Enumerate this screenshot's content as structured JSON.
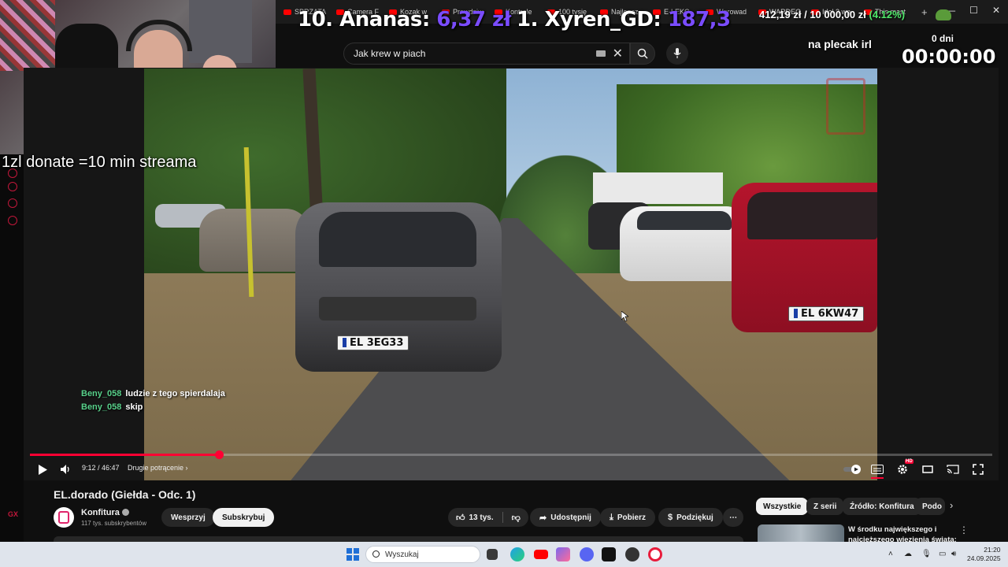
{
  "browser": {
    "tabs": [
      {
        "label": "SPRZATA",
        "icon": "youtube-icon"
      },
      {
        "label": "Camera F",
        "icon": "youtube-icon"
      },
      {
        "label": "Kozak w",
        "icon": "youtube-icon"
      },
      {
        "label": "Prawdziw",
        "icon": "youtube-icon"
      },
      {
        "label": "Kontrole",
        "icon": "youtube-icon"
      },
      {
        "label": "100 tysię",
        "icon": "youtube-icon"
      },
      {
        "label": "Najlepsz",
        "icon": "youtube-icon"
      },
      {
        "label": "E-LEKC",
        "icon": "youtube-icon"
      },
      {
        "label": "Wprowad",
        "icon": "youtube-icon"
      },
      {
        "label": "WARDEG",
        "icon": "youtube-icon"
      },
      {
        "label": "Idol 3 wp",
        "icon": "youtube-icon"
      },
      {
        "label": "This mast",
        "icon": "youtube-icon"
      }
    ],
    "new_tab": "+"
  },
  "overlay": {
    "rank10_label": "10. Ananas:",
    "rank10_amount": "6,37 zł",
    "rank1_label": "1. Xyren_GD:",
    "rank1_amount": "187,3",
    "goal_amount": "412,19 zł / 10 000,00 zł",
    "goal_pct": "(4.12%)",
    "backpack": "na plecak irl",
    "days": "0 dni",
    "timer": "00:00:00",
    "donate": "1zl donate =10 min streama"
  },
  "search": {
    "value": "Jak krew w piach"
  },
  "chat": [
    {
      "user": "Beny_058",
      "message": "ludzie z tego spierdalaja"
    },
    {
      "user": "Beny_058",
      "message": "skip"
    }
  ],
  "video": {
    "plate_vw": "EL 3EG33",
    "plate_red": "EL 6KW47"
  },
  "player": {
    "time": "9:12 / 46:47",
    "chapter": "Drugie potrącenie",
    "progress": 0.1968,
    "hd_badge": "HD"
  },
  "video_info": {
    "title": "EL.dorado (Giełda - Odc. 1)",
    "channel": "Konfitura",
    "subscribers": "117 tys. subskrybentów",
    "support_label": "Wesprzyj",
    "subscribe_label": "Subskrybuj",
    "likes": "13 tys.",
    "share_label": "Udostępnij",
    "download_label": "Pobierz",
    "thanks_label": "Podziękuj",
    "more_label": "⋯"
  },
  "chips": [
    {
      "label": "Wszystkie",
      "active": true
    },
    {
      "label": "Z serii",
      "active": false
    },
    {
      "label": "Źródło: Konfitura",
      "active": false
    },
    {
      "label": "Podo",
      "active": false
    }
  ],
  "recommendation": {
    "title": "W środku największego i najcięższego więzienia świata:"
  },
  "taskbar": {
    "search_placeholder": "Wyszukaj",
    "time": "21:20",
    "date": "24.09.2025"
  },
  "colors": {
    "accent_red": "#ff0033",
    "overlay_purple": "#7a4cff",
    "goal_green": "#4fe86a",
    "chat_user": "#58d08a"
  }
}
